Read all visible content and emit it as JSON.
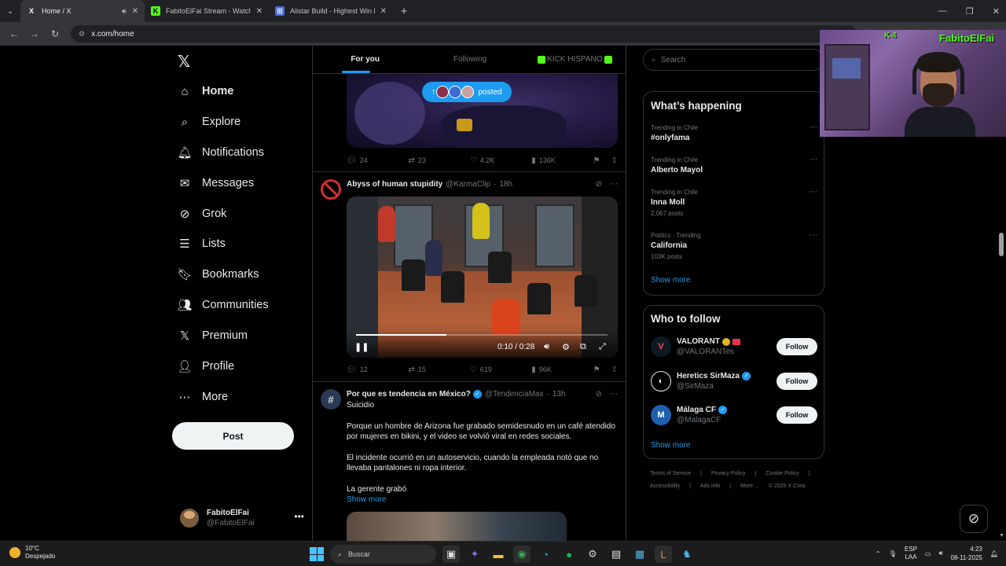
{
  "browser": {
    "tabs": [
      {
        "title": "Home / X",
        "favicon": "X"
      },
      {
        "title": "FabitoElFai Stream - Watch Live",
        "favicon": "K"
      },
      {
        "title": "Alistar Build - Highest Win Rate",
        "favicon": "⊞"
      }
    ],
    "url": "x.com/home"
  },
  "nav": {
    "items": [
      {
        "label": "Home",
        "icon": "home-icon"
      },
      {
        "label": "Explore",
        "icon": "search-icon"
      },
      {
        "label": "Notifications",
        "icon": "bell-icon"
      },
      {
        "label": "Messages",
        "icon": "envelope-icon"
      },
      {
        "label": "Grok",
        "icon": "grok-icon"
      },
      {
        "label": "Lists",
        "icon": "list-icon"
      },
      {
        "label": "Bookmarks",
        "icon": "bookmark-icon"
      },
      {
        "label": "Communities",
        "icon": "people-icon"
      },
      {
        "label": "Premium",
        "icon": "x-icon"
      },
      {
        "label": "Profile",
        "icon": "person-icon"
      },
      {
        "label": "More",
        "icon": "more-circle-icon"
      }
    ],
    "post_label": "Post",
    "account": {
      "name": "FabitoElFai",
      "handle": "@FabitoElFai"
    }
  },
  "feed": {
    "tabs": [
      "For you",
      "Following",
      "KICK HISPANO"
    ],
    "posted_pill": "posted",
    "tweet1_stats": {
      "replies": "24",
      "reposts": "23",
      "likes": "4.2K",
      "views": "136K"
    },
    "tweet2": {
      "name": "Abyss of human stupidity",
      "handle": "@KarmaClip",
      "time": "18h",
      "video_time": "0:10 / 0:28",
      "progress": 0.36,
      "stats": {
        "replies": "12",
        "reposts": "15",
        "likes": "619",
        "views": "96K"
      }
    },
    "tweet3": {
      "name": "Por que es tendencia en México?",
      "handle": "@TendenciaMax",
      "time": "13h",
      "line1": "Suicidio",
      "para1": "Porque un hombre de Arizona fue grabado semidesnudo en un café atendido por mujeres en bikini, y el video se volvió viral en redes sociales.",
      "para2": "El incidente ocurrió en un autoservicio, cuando la empleada notó que no llevaba pantalones ni ropa interior.",
      "para3": "La gerente grabó",
      "show_more": "Show more"
    }
  },
  "sidebar": {
    "search_placeholder": "Search",
    "happening_title": "What’s happening",
    "trends": [
      {
        "context": "Trending in Chile",
        "title": "#onlyfama",
        "posts": ""
      },
      {
        "context": "Trending in Chile",
        "title": "Alberto Mayol",
        "posts": ""
      },
      {
        "context": "Trending in Chile",
        "title": "Inna Moll",
        "posts": "2,067 posts"
      },
      {
        "context": "Politics · Trending",
        "title": "California",
        "posts": "103K posts"
      }
    ],
    "show_more": "Show more",
    "wtf_title": "Who to follow",
    "follow_label": "Follow",
    "follows": [
      {
        "name": "VALORANT",
        "handle": "@VALORANTes"
      },
      {
        "name": "Heretics SirMaza",
        "handle": "@SirMaza"
      },
      {
        "name": "Málaga CF",
        "handle": "@MalagaCF"
      }
    ],
    "footer_row1": [
      "Terms of Service",
      "|",
      "Privacy Policy",
      "|",
      "Cookie Policy",
      "|"
    ],
    "footer_row2": [
      "Accessibility",
      "|",
      "Ads info",
      "|",
      "More ...",
      "© 2025 X Corp."
    ]
  },
  "webcam": {
    "label": "FabitoElFai",
    "badge": "K 4"
  },
  "taskbar": {
    "temp": "10°C",
    "weather": "Despejado",
    "search": "Buscar",
    "lang1": "ESP",
    "lang2": "LAA",
    "time": "4:23",
    "date": "08-11-2025"
  },
  "colors": {
    "accent": "#1d9bf0",
    "kick_green": "#53fc18",
    "bg": "#000000"
  }
}
